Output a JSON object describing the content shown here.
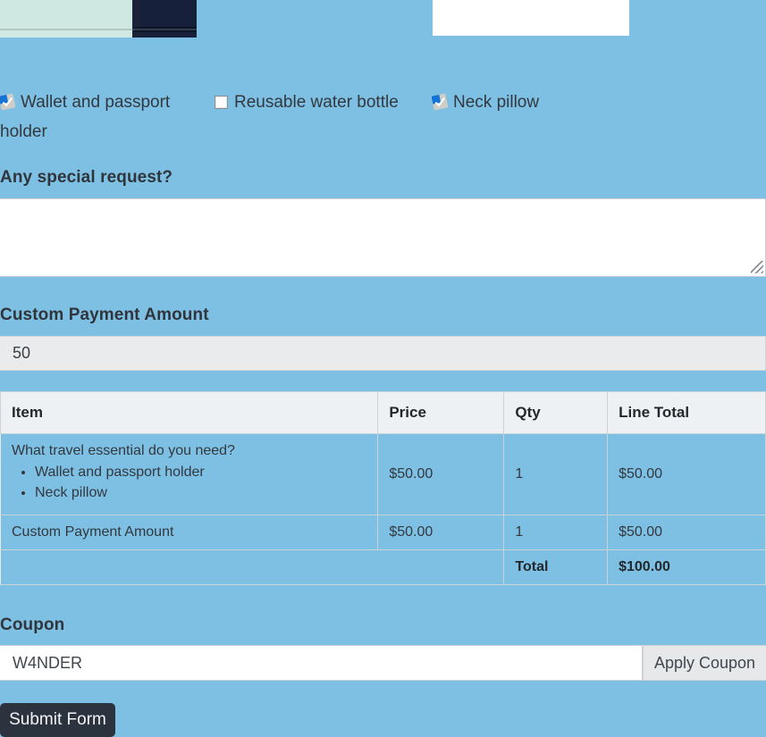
{
  "page": {
    "background_color": "#7ec0e4"
  },
  "question": {
    "title": "What travel essential do you need?",
    "options": [
      {
        "label": "Wallet and passport holder",
        "checked": true,
        "image_alt": "wallet-and-passport-holder-photo"
      },
      {
        "label": "Reusable water bottle",
        "checked": false,
        "image_alt": "reusable-water-bottle-photo"
      },
      {
        "label": "Neck pillow",
        "checked": true,
        "image_alt": "neck-pillow-photo"
      }
    ]
  },
  "special_request": {
    "label": "Any special request?",
    "value": "",
    "placeholder": ""
  },
  "custom_payment": {
    "label": "Custom Payment Amount",
    "value": "50",
    "placeholder": ""
  },
  "summary_table": {
    "headers": {
      "item": "Item",
      "price": "Price",
      "qty": "Qty",
      "line_total": "Line Total"
    },
    "rows": [
      {
        "item_title": "What travel essential do you need?",
        "item_bullets": [
          "Wallet and passport holder",
          "Neck pillow"
        ],
        "price": "$50.00",
        "qty": "1",
        "line_total": "$50.00"
      },
      {
        "item_title": "Custom Payment Amount",
        "item_bullets": [],
        "price": "$50.00",
        "qty": "1",
        "line_total": "$50.00"
      }
    ],
    "total_label": "Total",
    "total_value": "$100.00"
  },
  "coupon": {
    "label": "Coupon",
    "value": "W4NDER",
    "placeholder": "",
    "apply_label": "Apply Coupon"
  },
  "submit": {
    "label": "Submit Form"
  }
}
